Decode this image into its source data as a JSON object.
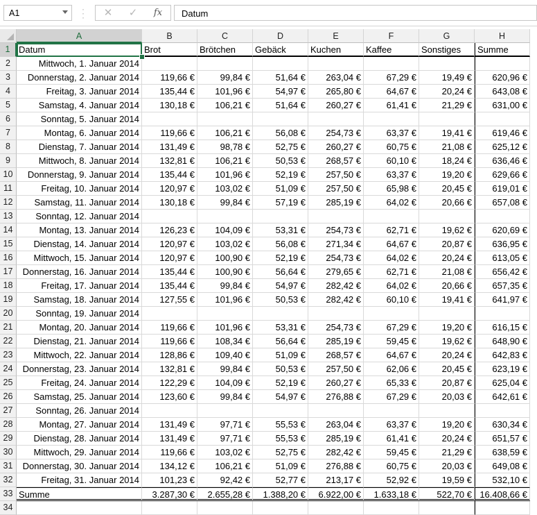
{
  "formula_bar": {
    "name_box": "A1",
    "formula": "Datum",
    "cancel_icon": "x-icon",
    "enter_icon": "check-icon",
    "fx_label": "fx"
  },
  "columns": [
    "A",
    "B",
    "C",
    "D",
    "E",
    "F",
    "G",
    "H"
  ],
  "header": [
    "Datum",
    "Brot",
    "Brötchen",
    "Gebäck",
    "Kuchen",
    "Kaffee",
    "Sonstiges",
    "Summe"
  ],
  "rows": [
    [
      "Mittwoch, 1. Januar 2014",
      "",
      "",
      "",
      "",
      "",
      "",
      ""
    ],
    [
      "Donnerstag, 2. Januar 2014",
      "119,66 €",
      "99,84 €",
      "51,64 €",
      "263,04 €",
      "67,29 €",
      "19,49 €",
      "620,96 €"
    ],
    [
      "Freitag, 3. Januar 2014",
      "135,44 €",
      "101,96 €",
      "54,97 €",
      "265,80 €",
      "64,67 €",
      "20,24 €",
      "643,08 €"
    ],
    [
      "Samstag, 4. Januar 2014",
      "130,18 €",
      "106,21 €",
      "51,64 €",
      "260,27 €",
      "61,41 €",
      "21,29 €",
      "631,00 €"
    ],
    [
      "Sonntag, 5. Januar 2014",
      "",
      "",
      "",
      "",
      "",
      "",
      ""
    ],
    [
      "Montag, 6. Januar 2014",
      "119,66 €",
      "106,21 €",
      "56,08 €",
      "254,73 €",
      "63,37 €",
      "19,41 €",
      "619,46 €"
    ],
    [
      "Dienstag, 7. Januar 2014",
      "131,49 €",
      "98,78 €",
      "52,75 €",
      "260,27 €",
      "60,75 €",
      "21,08 €",
      "625,12 €"
    ],
    [
      "Mittwoch, 8. Januar 2014",
      "132,81 €",
      "106,21 €",
      "50,53 €",
      "268,57 €",
      "60,10 €",
      "18,24 €",
      "636,46 €"
    ],
    [
      "Donnerstag, 9. Januar 2014",
      "135,44 €",
      "101,96 €",
      "52,19 €",
      "257,50 €",
      "63,37 €",
      "19,20 €",
      "629,66 €"
    ],
    [
      "Freitag, 10. Januar 2014",
      "120,97 €",
      "103,02 €",
      "51,09 €",
      "257,50 €",
      "65,98 €",
      "20,45 €",
      "619,01 €"
    ],
    [
      "Samstag, 11. Januar 2014",
      "130,18 €",
      "99,84 €",
      "57,19 €",
      "285,19 €",
      "64,02 €",
      "20,66 €",
      "657,08 €"
    ],
    [
      "Sonntag, 12. Januar 2014",
      "",
      "",
      "",
      "",
      "",
      "",
      ""
    ],
    [
      "Montag, 13. Januar 2014",
      "126,23 €",
      "104,09 €",
      "53,31 €",
      "254,73 €",
      "62,71 €",
      "19,62 €",
      "620,69 €"
    ],
    [
      "Dienstag, 14. Januar 2014",
      "120,97 €",
      "103,02 €",
      "56,08 €",
      "271,34 €",
      "64,67 €",
      "20,87 €",
      "636,95 €"
    ],
    [
      "Mittwoch, 15. Januar 2014",
      "120,97 €",
      "100,90 €",
      "52,19 €",
      "254,73 €",
      "64,02 €",
      "20,24 €",
      "613,05 €"
    ],
    [
      "Donnerstag, 16. Januar 2014",
      "135,44 €",
      "100,90 €",
      "56,64 €",
      "279,65 €",
      "62,71 €",
      "21,08 €",
      "656,42 €"
    ],
    [
      "Freitag, 17. Januar 2014",
      "135,44 €",
      "99,84 €",
      "54,97 €",
      "282,42 €",
      "64,02 €",
      "20,66 €",
      "657,35 €"
    ],
    [
      "Samstag, 18. Januar 2014",
      "127,55 €",
      "101,96 €",
      "50,53 €",
      "282,42 €",
      "60,10 €",
      "19,41 €",
      "641,97 €"
    ],
    [
      "Sonntag, 19. Januar 2014",
      "",
      "",
      "",
      "",
      "",
      "",
      ""
    ],
    [
      "Montag, 20. Januar 2014",
      "119,66 €",
      "101,96 €",
      "53,31 €",
      "254,73 €",
      "67,29 €",
      "19,20 €",
      "616,15 €"
    ],
    [
      "Dienstag, 21. Januar 2014",
      "119,66 €",
      "108,34 €",
      "56,64 €",
      "285,19 €",
      "59,45 €",
      "19,62 €",
      "648,90 €"
    ],
    [
      "Mittwoch, 22. Januar 2014",
      "128,86 €",
      "109,40 €",
      "51,09 €",
      "268,57 €",
      "64,67 €",
      "20,24 €",
      "642,83 €"
    ],
    [
      "Donnerstag, 23. Januar 2014",
      "132,81 €",
      "99,84 €",
      "50,53 €",
      "257,50 €",
      "62,06 €",
      "20,45 €",
      "623,19 €"
    ],
    [
      "Freitag, 24. Januar 2014",
      "122,29 €",
      "104,09 €",
      "52,19 €",
      "260,27 €",
      "65,33 €",
      "20,87 €",
      "625,04 €"
    ],
    [
      "Samstag, 25. Januar 2014",
      "123,60 €",
      "99,84 €",
      "54,97 €",
      "276,88 €",
      "67,29 €",
      "20,03 €",
      "642,61 €"
    ],
    [
      "Sonntag, 26. Januar 2014",
      "",
      "",
      "",
      "",
      "",
      "",
      ""
    ],
    [
      "Montag, 27. Januar 2014",
      "131,49 €",
      "97,71 €",
      "55,53 €",
      "263,04 €",
      "63,37 €",
      "19,20 €",
      "630,34 €"
    ],
    [
      "Dienstag, 28. Januar 2014",
      "131,49 €",
      "97,71 €",
      "55,53 €",
      "285,19 €",
      "61,41 €",
      "20,24 €",
      "651,57 €"
    ],
    [
      "Mittwoch, 29. Januar 2014",
      "119,66 €",
      "103,02 €",
      "52,75 €",
      "282,42 €",
      "59,45 €",
      "21,29 €",
      "638,59 €"
    ],
    [
      "Donnerstag, 30. Januar 2014",
      "134,12 €",
      "106,21 €",
      "51,09 €",
      "276,88 €",
      "60,75 €",
      "20,03 €",
      "649,08 €"
    ],
    [
      "Freitag, 31. Januar 2014",
      "101,23 €",
      "92,42 €",
      "52,77 €",
      "213,17 €",
      "52,92 €",
      "19,59 €",
      "532,10 €"
    ]
  ],
  "summary": [
    "Summe",
    "3.287,30 €",
    "2.655,28 €",
    "1.388,20 €",
    "6.922,00 €",
    "1.633,18 €",
    "522,70 €",
    "16.408,66 €"
  ]
}
